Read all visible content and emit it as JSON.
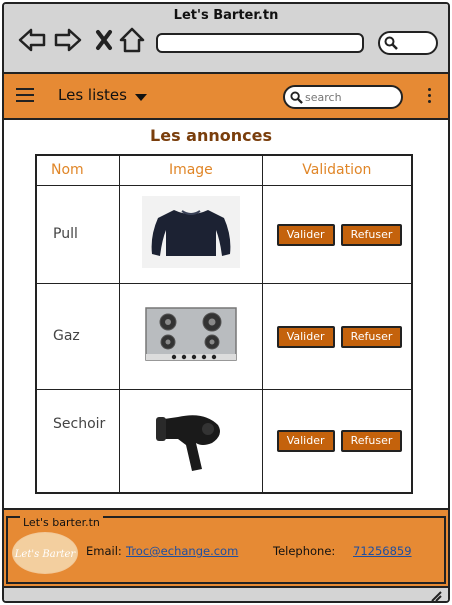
{
  "window": {
    "title": "Let's Barter.tn"
  },
  "navbar": {
    "menu_label": "Les listes",
    "search_placeholder": "search"
  },
  "main": {
    "title": "Les annonces",
    "table": {
      "headers": [
        "Nom",
        "Image",
        "Validation"
      ],
      "rows": [
        {
          "name": "Pull",
          "image": "sweater-image"
        },
        {
          "name": "Gaz",
          "image": "gas-stove-image"
        },
        {
          "name": "Sechoir",
          "image": "hair-dryer-image"
        }
      ],
      "validate_label": "Valider",
      "refuse_label": "Refuser"
    }
  },
  "footer": {
    "title": "Let's barter.tn",
    "logo_text": "Let's Barter",
    "email_label": "Email:",
    "email": "Troc@echange.com",
    "phone_label": "Telephone:",
    "phone": "71256859"
  },
  "colors": {
    "accent": "#e68a34",
    "button": "#c4620c",
    "title": "#7a3e0c",
    "chrome": "#d4d4d4"
  }
}
